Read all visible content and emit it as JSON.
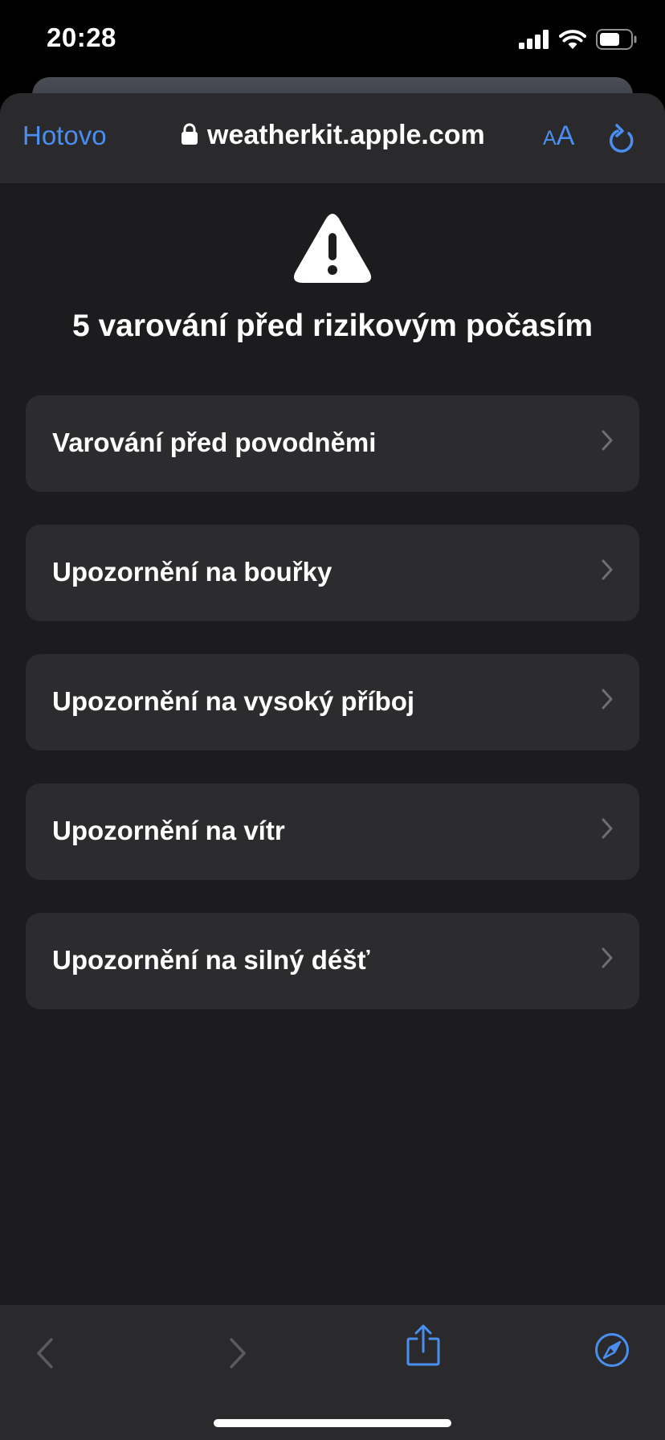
{
  "status_bar": {
    "time": "20:28",
    "icons": [
      "signal-icon",
      "wifi-icon",
      "battery-icon"
    ]
  },
  "nav": {
    "done_label": "Hotovo",
    "url": "weatherkit.apple.com",
    "text_size_small": "A",
    "text_size_large": "A",
    "icons": [
      "lock-icon",
      "reload-icon"
    ]
  },
  "page": {
    "warning_icon": "warning-triangle-icon",
    "title": "5 varování před rizikovým počasím",
    "alerts": [
      {
        "label": "Varování před povodněmi"
      },
      {
        "label": "Upozornění na bouřky"
      },
      {
        "label": "Upozornění na vysoký příboj"
      },
      {
        "label": "Upozornění na vítr"
      },
      {
        "label": "Upozornění na silný déšť"
      }
    ]
  },
  "toolbar": {
    "icons": [
      "back-icon",
      "forward-icon",
      "share-icon",
      "compass-icon"
    ]
  },
  "colors": {
    "accent": "#4a8ef0",
    "sheet_background": "#1c1c1e",
    "bar_background": "#2a2a2c",
    "row_background": "#2c2c2e"
  }
}
